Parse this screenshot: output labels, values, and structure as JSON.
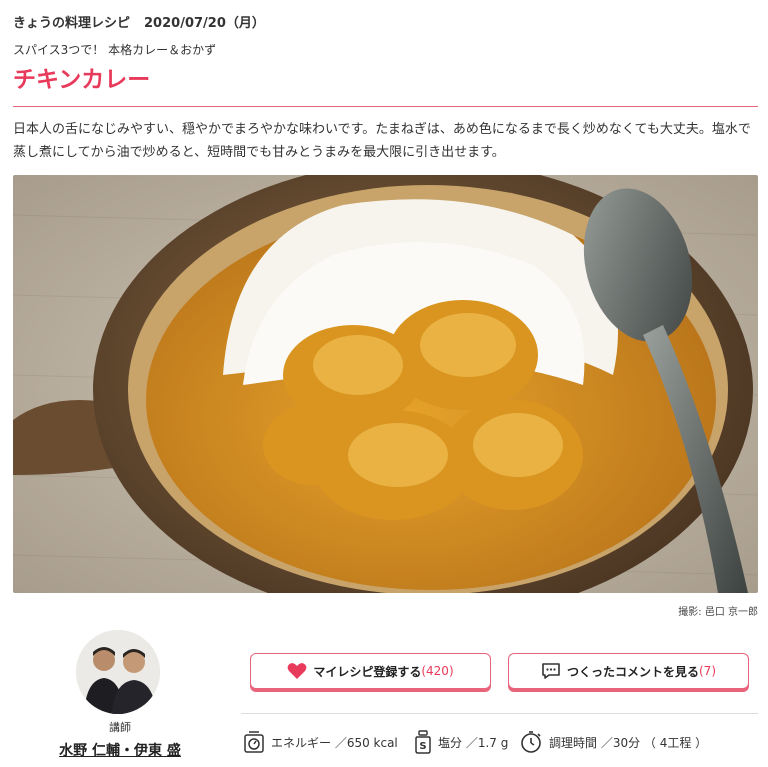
{
  "header": {
    "program": "きょうの料理レシピ",
    "date": "2020/07/20（月）"
  },
  "recipe": {
    "series": "スパイス3つで！ 本格カレー＆おかず",
    "title": "チキンカレー",
    "description": "日本人の舌になじみやすい、穏やかでまろやかな味わいです。たまねぎは、あめ色になるまで長く炒めなくても大丈夫。塩水で蒸し煮にしてから油で炒めると、短時間でも甘みとうまみを最大限に引き出せます。",
    "photo_credit": "撮影: 邑口 京一郎"
  },
  "instructor": {
    "role": "講師",
    "names": "水野 仁輔・伊東 盛"
  },
  "actions": {
    "my_recipe_label": "マイレシピ登録する",
    "my_recipe_count": "(420)",
    "comments_label": "つくったコメントを見る",
    "comments_count": "(7)"
  },
  "nutrition": {
    "energy": "エネルギー ／650 kcal",
    "salt": "塩分 ／1.7 g",
    "time": "調理時間 ／30分 （ 4工程 ）"
  },
  "colors": {
    "accent": "#e83a5a",
    "border": "#e8637c"
  },
  "icons": [
    "heart-icon",
    "comment-icon",
    "scale-icon",
    "salt-icon",
    "timer-icon"
  ]
}
